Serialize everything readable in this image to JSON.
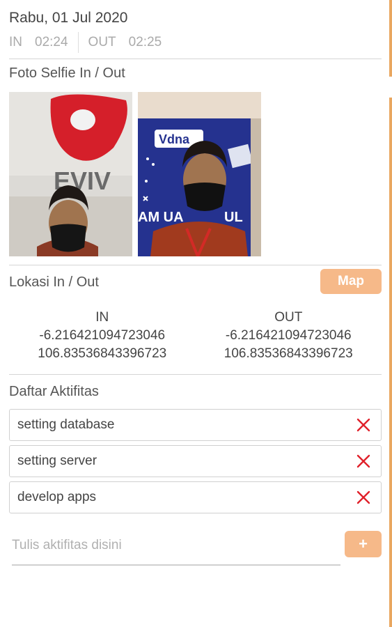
{
  "header": {
    "date": "Rabu, 01 Jul 2020",
    "in_label": "IN",
    "in_time": "02:24",
    "out_label": "OUT",
    "out_time": "02:25"
  },
  "selfie": {
    "title": "Foto Selfie In / Out"
  },
  "location": {
    "title": "Lokasi In / Out",
    "map_button": "Map",
    "in": {
      "label": "IN",
      "lat": "-6.216421094723046",
      "lng": "106.83536843396723"
    },
    "out": {
      "label": "OUT",
      "lat": "-6.216421094723046",
      "lng": "106.83536843396723"
    }
  },
  "activities": {
    "title": "Daftar Aktifitas",
    "items": [
      {
        "label": "setting database"
      },
      {
        "label": "setting server"
      },
      {
        "label": "develop apps"
      }
    ],
    "input_placeholder": "Tulis aktifitas disini",
    "input_value": "",
    "add_button": "+"
  },
  "colors": {
    "accent": "#f6b989",
    "delete": "#e0202a",
    "edge": "#e9a760"
  },
  "icons": {
    "delete": "close-icon"
  }
}
